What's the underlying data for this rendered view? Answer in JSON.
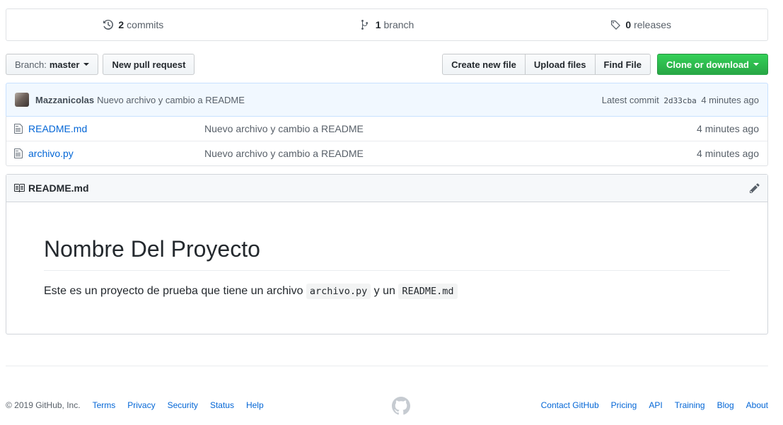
{
  "summary": {
    "commits_count": "2",
    "commits_label": "commits",
    "branches_count": "1",
    "branches_label": "branch",
    "releases_count": "0",
    "releases_label": "releases"
  },
  "file_nav": {
    "branch_prefix": "Branch:",
    "branch_name": "master",
    "new_pull_request": "New pull request",
    "create_new_file": "Create new file",
    "upload_files": "Upload files",
    "find_file": "Find File",
    "clone_or_download": "Clone or download"
  },
  "commit": {
    "author": "Mazzanicolas",
    "message": "Nuevo archivo y cambio a README",
    "latest_label": "Latest commit",
    "sha": "2d33cba",
    "age": "4 minutes ago"
  },
  "files": [
    {
      "name": "README.md",
      "message": "Nuevo archivo y cambio a README",
      "age": "4 minutes ago",
      "icon": "file-icon"
    },
    {
      "name": "archivo.py",
      "message": "Nuevo archivo y cambio a README",
      "age": "4 minutes ago",
      "icon": "file-icon"
    }
  ],
  "readme": {
    "header_title": "README.md",
    "heading": "Nombre Del Proyecto",
    "text_before": "Este es un proyecto de prueba que tiene un archivo ",
    "code1": "archivo.py",
    "text_middle": " y un ",
    "code2": "README.md"
  },
  "footer": {
    "copyright": "© 2019 GitHub, Inc.",
    "left_links": [
      "Terms",
      "Privacy",
      "Security",
      "Status",
      "Help"
    ],
    "right_links": [
      "Contact GitHub",
      "Pricing",
      "API",
      "Training",
      "Blog",
      "About"
    ]
  },
  "colors": {
    "link": "#0366d6",
    "primary_button": "#28a745",
    "commit_bg": "#f1f8ff"
  }
}
